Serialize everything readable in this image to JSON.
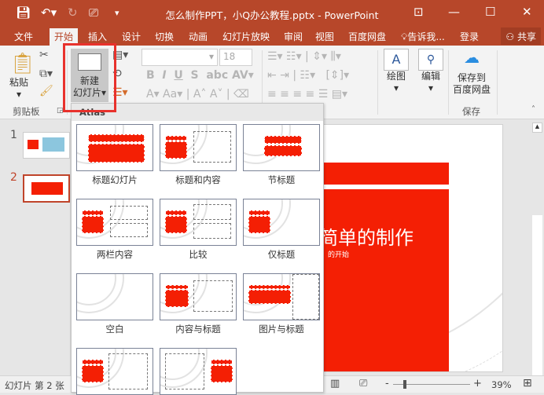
{
  "window": {
    "title": "怎么制作PPT，小Q办公教程.pptx - PowerPoint"
  },
  "tabs": [
    "文件",
    "开始",
    "插入",
    "设计",
    "切换",
    "动画",
    "幻灯片放映",
    "审阅",
    "视图",
    "百度网盘"
  ],
  "active_tab": "开始",
  "tell_me": "告诉我...",
  "login": "登录",
  "share": "共享",
  "ribbon": {
    "paste": "粘贴",
    "clipboard": "剪贴板",
    "new_slide_1": "新建",
    "new_slide_2": "幻灯片",
    "font_size": "18",
    "draw": "绘图",
    "edit": "编辑",
    "save_to_1": "保存到",
    "save_to_2": "百度网盘",
    "save_group": "保存"
  },
  "slides": [
    {
      "num": "1"
    },
    {
      "num": "2"
    }
  ],
  "slide": {
    "title": "简单的制作",
    "subtitle": "的开始"
  },
  "dropdown": {
    "header": "Atlas",
    "layouts": [
      {
        "label": "标题幻灯片",
        "kind": "title"
      },
      {
        "label": "标题和内容",
        "kind": "title-content"
      },
      {
        "label": "节标题",
        "kind": "section"
      },
      {
        "label": "两栏内容",
        "kind": "two-content"
      },
      {
        "label": "比较",
        "kind": "compare"
      },
      {
        "label": "仅标题",
        "kind": "title-only"
      },
      {
        "label": "空白",
        "kind": "blank"
      },
      {
        "label": "内容与标题",
        "kind": "content-caption"
      },
      {
        "label": "图片与标题",
        "kind": "picture-caption"
      },
      {
        "label": "",
        "kind": "left-red"
      },
      {
        "label": "",
        "kind": "right-red"
      }
    ]
  },
  "status": {
    "slide_info": "幻灯片 第 2 张",
    "zoom": "39%",
    "zoom_level": 0.39
  },
  "colors": {
    "brand": "#b7472a",
    "accent_red": "#f41f04",
    "highlight": "#e8312c"
  }
}
